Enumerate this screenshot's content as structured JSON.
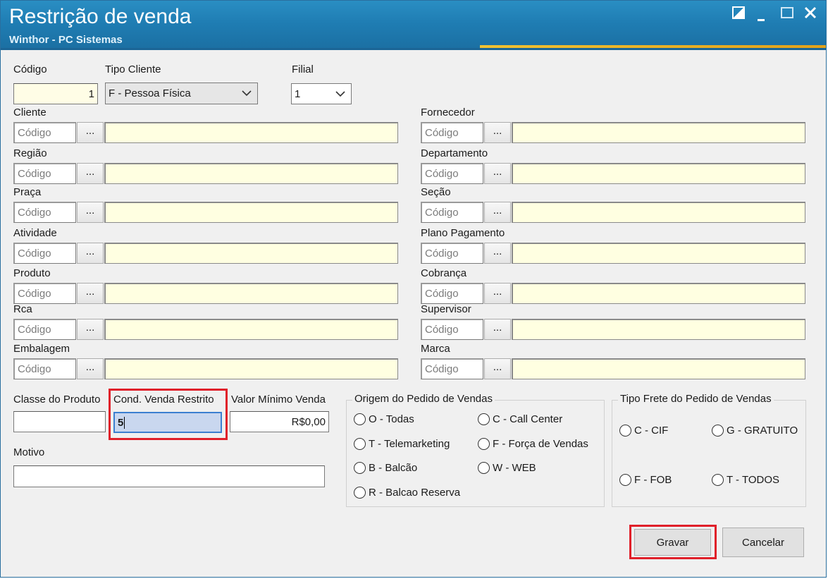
{
  "window": {
    "title": "Restrição de venda",
    "subtitle": "Winthor - PC Sistemas"
  },
  "top": {
    "codigo": {
      "label": "Código",
      "value": "1"
    },
    "tipo_cliente": {
      "label": "Tipo Cliente",
      "value": "F - Pessoa Física"
    },
    "filial": {
      "label": "Filial",
      "value": "1"
    }
  },
  "left_fields": [
    {
      "label": "Cliente",
      "placeholder": "Código",
      "button": "..."
    },
    {
      "label": "Região",
      "placeholder": "Código",
      "button": "..."
    },
    {
      "label": "Praça",
      "placeholder": "Código",
      "button": "..."
    },
    {
      "label": "Atividade",
      "placeholder": "Código",
      "button": "..."
    },
    {
      "label": "Produto",
      "placeholder": "Código",
      "button": "..."
    },
    {
      "label": "Rca",
      "placeholder": "Código",
      "button": "..."
    },
    {
      "label": "Embalagem",
      "placeholder": "Código",
      "button": "..."
    }
  ],
  "right_fields": [
    {
      "label": "Fornecedor",
      "placeholder": "Código",
      "button": "..."
    },
    {
      "label": "Departamento",
      "placeholder": "Código",
      "button": "..."
    },
    {
      "label": "Seção",
      "placeholder": "Código",
      "button": "..."
    },
    {
      "label": "Plano Pagamento",
      "placeholder": "Código",
      "button": "..."
    },
    {
      "label": "Cobrança",
      "placeholder": "Código",
      "button": "..."
    },
    {
      "label": "Supervisor",
      "placeholder": "Código",
      "button": "..."
    },
    {
      "label": "Marca",
      "placeholder": "Código",
      "button": "..."
    }
  ],
  "bottom": {
    "classe_produto": {
      "label": "Classe do Produto",
      "value": ""
    },
    "cond_venda": {
      "label": "Cond. Venda Restrito",
      "value": "5"
    },
    "valor_minimo": {
      "label": "Valor Mínimo Venda",
      "value": "R$0,00"
    },
    "motivo": {
      "label": "Motivo",
      "value": ""
    }
  },
  "origem": {
    "title": "Origem do Pedido de Vendas",
    "options": [
      "O - Todas",
      "C - Call Center",
      "T - Telemarketing",
      "F - Força de Vendas",
      "B - Balcão",
      "W - WEB",
      "R - Balcao Reserva"
    ]
  },
  "frete": {
    "title": "Tipo Frete do Pedido de Vendas",
    "options": [
      "C - CIF",
      "G - GRATUITO",
      "F - FOB",
      "T - TODOS"
    ]
  },
  "buttons": {
    "save": "Gravar",
    "cancel": "Cancelar"
  },
  "colors": {
    "titlebar": "#1f7db3",
    "highlight": "#e0202a",
    "field_yellow": "#ffffe1"
  }
}
